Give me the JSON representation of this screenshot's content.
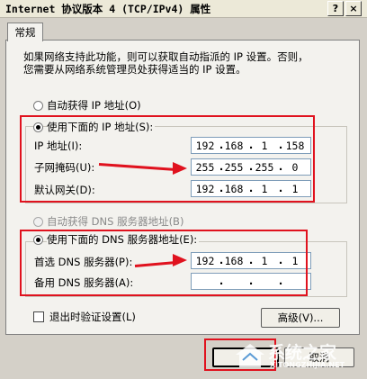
{
  "window": {
    "title": "Internet 协议版本 4 (TCP/IPv4) 属性",
    "help_button": "?",
    "close_button": "×"
  },
  "tab": {
    "label": "常规"
  },
  "description": {
    "line1": "如果网络支持此功能，则可以获取自动指派的 IP 设置。否则，",
    "line2": "您需要从网络系统管理员处获得适当的 IP 设置。"
  },
  "ip_mode": {
    "auto_label": "自动获得 IP 地址(O)",
    "manual_label": "使用下面的 IP 地址(S):",
    "selected": "manual"
  },
  "ip_fields": [
    {
      "label": "IP 地址(I):",
      "octets": [
        "192",
        "168",
        "1",
        "158"
      ]
    },
    {
      "label": "子网掩码(U):",
      "octets": [
        "255",
        "255",
        "255",
        "0"
      ]
    },
    {
      "label": "默认网关(D):",
      "octets": [
        "192",
        "168",
        "1",
        "1"
      ]
    }
  ],
  "dns_mode": {
    "auto_label": "自动获得 DNS 服务器地址(B)",
    "manual_label": "使用下面的 DNS 服务器地址(E):",
    "selected": "manual"
  },
  "dns_fields": [
    {
      "label": "首选 DNS 服务器(P):",
      "octets": [
        "192",
        "168",
        "1",
        "1"
      ]
    },
    {
      "label": "备用 DNS 服务器(A):",
      "octets": [
        "",
        "",
        "",
        ""
      ]
    }
  ],
  "validate_on_exit": {
    "label": "退出时验证设置(L)",
    "checked": false
  },
  "buttons": {
    "advanced": "高级(V)...",
    "cancel": "取消"
  },
  "watermark": {
    "text": "系统之家",
    "url": "XITONGZHIJIA.NET"
  },
  "colors": {
    "annotation_red": "#e0121e",
    "dialog_bg": "#f3f2ee"
  }
}
